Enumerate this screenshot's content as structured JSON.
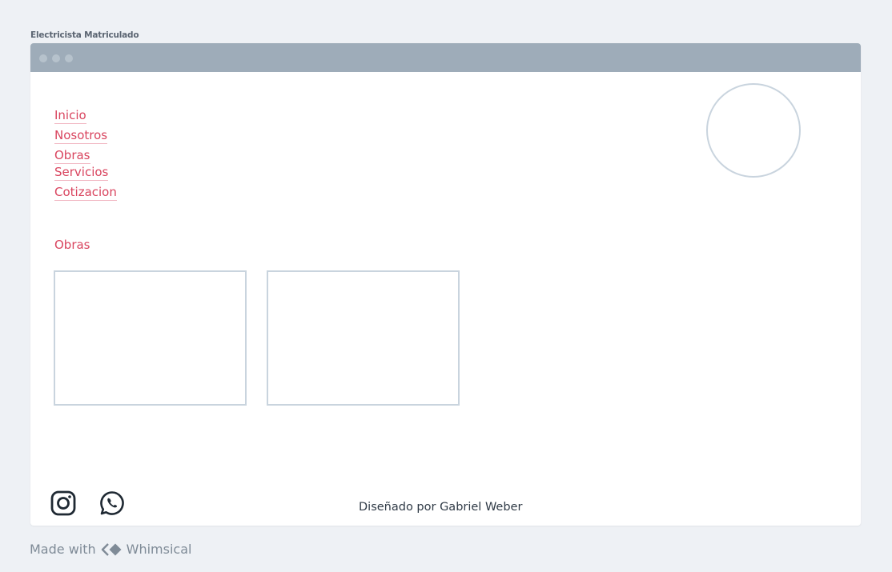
{
  "frame": {
    "title": "Electricista Matriculado"
  },
  "nav": {
    "items": [
      {
        "label": "Inicio"
      },
      {
        "label": "Nosotros"
      },
      {
        "label": "Obras"
      },
      {
        "label": "Servicios"
      },
      {
        "label": "Cotizacion"
      }
    ]
  },
  "main": {
    "section_title": "Obras"
  },
  "footer": {
    "icons": [
      "instagram-icon",
      "whatsapp-icon"
    ],
    "credit": "Diseñado por Gabriel Weber"
  },
  "watermark": {
    "prefix": "Made with",
    "brand": "Whimsical"
  },
  "colors": {
    "accent": "#d9455f",
    "titlebar": "#9eacb9",
    "placeholder_border": "#c9d4de",
    "background": "#eef1f5"
  }
}
